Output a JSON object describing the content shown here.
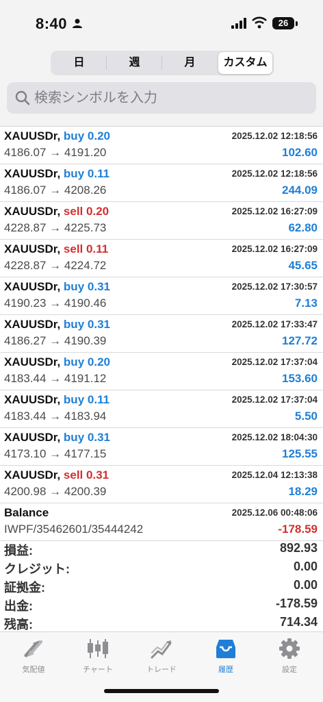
{
  "status_bar": {
    "time": "8:40",
    "battery": "26"
  },
  "period_tabs": {
    "day": "日",
    "week": "週",
    "month": "月",
    "custom": "カスタム",
    "active": "custom"
  },
  "search": {
    "placeholder": "検索シンボルを入力"
  },
  "trades": [
    {
      "symbol": "XAUUSDr,",
      "side": "buy",
      "volume": "0.20",
      "prices": "4186.07 → 4191.20",
      "datetime": "2025.12.02 12:18:56",
      "profit": "102.60"
    },
    {
      "symbol": "XAUUSDr,",
      "side": "buy",
      "volume": "0.11",
      "prices": "4186.07 → 4208.26",
      "datetime": "2025.12.02 12:18:56",
      "profit": "244.09"
    },
    {
      "symbol": "XAUUSDr,",
      "side": "sell",
      "volume": "0.20",
      "prices": "4228.87 → 4225.73",
      "datetime": "2025.12.02 16:27:09",
      "profit": "62.80"
    },
    {
      "symbol": "XAUUSDr,",
      "side": "sell",
      "volume": "0.11",
      "prices": "4228.87 → 4224.72",
      "datetime": "2025.12.02 16:27:09",
      "profit": "45.65"
    },
    {
      "symbol": "XAUUSDr,",
      "side": "buy",
      "volume": "0.31",
      "prices": "4190.23 → 4190.46",
      "datetime": "2025.12.02 17:30:57",
      "profit": "7.13"
    },
    {
      "symbol": "XAUUSDr,",
      "side": "buy",
      "volume": "0.31",
      "prices": "4186.27 → 4190.39",
      "datetime": "2025.12.02 17:33:47",
      "profit": "127.72"
    },
    {
      "symbol": "XAUUSDr,",
      "side": "buy",
      "volume": "0.20",
      "prices": "4183.44 → 4191.12",
      "datetime": "2025.12.02 17:37:04",
      "profit": "153.60"
    },
    {
      "symbol": "XAUUSDr,",
      "side": "buy",
      "volume": "0.11",
      "prices": "4183.44 → 4183.94",
      "datetime": "2025.12.02 17:37:04",
      "profit": "5.50"
    },
    {
      "symbol": "XAUUSDr,",
      "side": "buy",
      "volume": "0.31",
      "prices": "4173.10 → 4177.15",
      "datetime": "2025.12.02 18:04:30",
      "profit": "125.55"
    },
    {
      "symbol": "XAUUSDr,",
      "side": "sell",
      "volume": "0.31",
      "prices": "4200.98 → 4200.39",
      "datetime": "2025.12.04 12:13:38",
      "profit": "18.29"
    }
  ],
  "balance_entry": {
    "title": "Balance",
    "comment": "IWPF/35462601/35444242",
    "datetime": "2025.12.06 00:48:06",
    "amount": "-178.59"
  },
  "summary": [
    {
      "label": "損益:",
      "value": "892.93"
    },
    {
      "label": "クレジット:",
      "value": "0.00"
    },
    {
      "label": "証拠金:",
      "value": "0.00"
    },
    {
      "label": "出金:",
      "value": "-178.59"
    },
    {
      "label": "残高:",
      "value": "714.34"
    }
  ],
  "tabbar": [
    {
      "label": "気配値",
      "icon": "quotes-icon"
    },
    {
      "label": "チャート",
      "icon": "candlestick-icon"
    },
    {
      "label": "トレード",
      "icon": "trade-icon"
    },
    {
      "label": "履歴",
      "icon": "history-inbox-icon"
    },
    {
      "label": "設定",
      "icon": "gear-icon"
    }
  ],
  "colors": {
    "positive": "#1f7fd6",
    "negative": "#d32f2f"
  }
}
